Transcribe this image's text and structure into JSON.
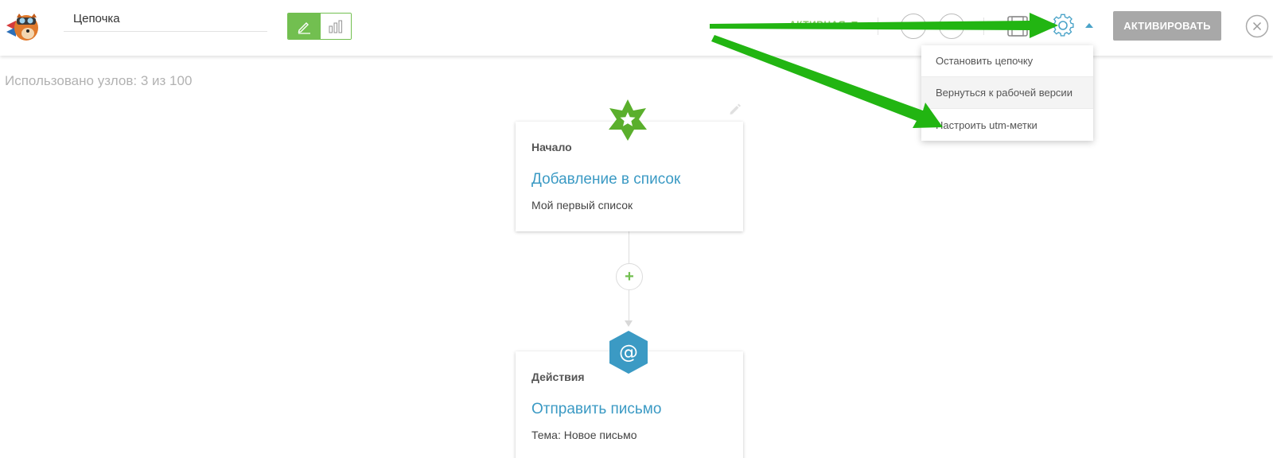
{
  "header": {
    "chain_name": "Цепочка",
    "status_label": "АКТИВНАЯ",
    "activate_label": "АКТИВИРОВАТЬ"
  },
  "icons": {
    "logo": "fox-mascot-logo",
    "edit_mode": "pencil-icon",
    "stats_mode": "bar-chart-icon",
    "save": "save-icon",
    "settings": "gear-icon",
    "close": "close-icon"
  },
  "settings_menu": {
    "items": [
      {
        "label": "Остановить цепочку"
      },
      {
        "label": "Вернуться к рабочей версии"
      },
      {
        "label": "Настроить utm-метки"
      }
    ]
  },
  "usage_text": "Использовано узлов: 3 из 100",
  "flow": {
    "nodes": [
      {
        "category": "Начало",
        "title": "Добавление в список",
        "description": "Мой первый список",
        "badge_icon": "star-icon",
        "badge_color": "#5aaf2c"
      },
      {
        "category": "Действия",
        "title": "Отправить письмо",
        "description": "Тема: Новое письмо",
        "badge_icon": "at-sign-icon",
        "badge_color": "#3b9ac4"
      }
    ],
    "add_button": "+"
  },
  "colors": {
    "accent_green": "#72bf50",
    "link_blue": "#3b9ac4",
    "annotation_arrow": "#22b512",
    "activate_bg": "#a8a8a8"
  }
}
